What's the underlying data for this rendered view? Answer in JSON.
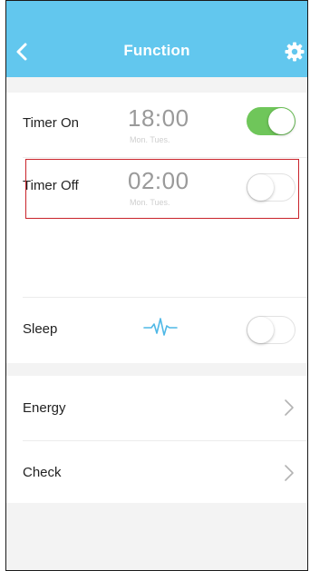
{
  "header": {
    "title": "Function",
    "background": "#62c7ee",
    "back_icon": "chevron-left-icon",
    "settings_icon": "gear-icon"
  },
  "timer_on": {
    "label": "Timer On",
    "time": "18:00",
    "days": "Mon. Tues.",
    "enabled": true,
    "toggle_color": "#6fc65a"
  },
  "timer_off": {
    "label": "Timer Off",
    "time": "02:00",
    "days": "Mon. Tues.",
    "enabled": false,
    "highlight_color": "#c9232a"
  },
  "sleep": {
    "label": "Sleep",
    "icon": "heartbeat-icon",
    "enabled": false
  },
  "energy": {
    "label": "Energy",
    "icon": "chevron-right-icon"
  },
  "check": {
    "label": "Check",
    "icon": "chevron-right-icon"
  }
}
